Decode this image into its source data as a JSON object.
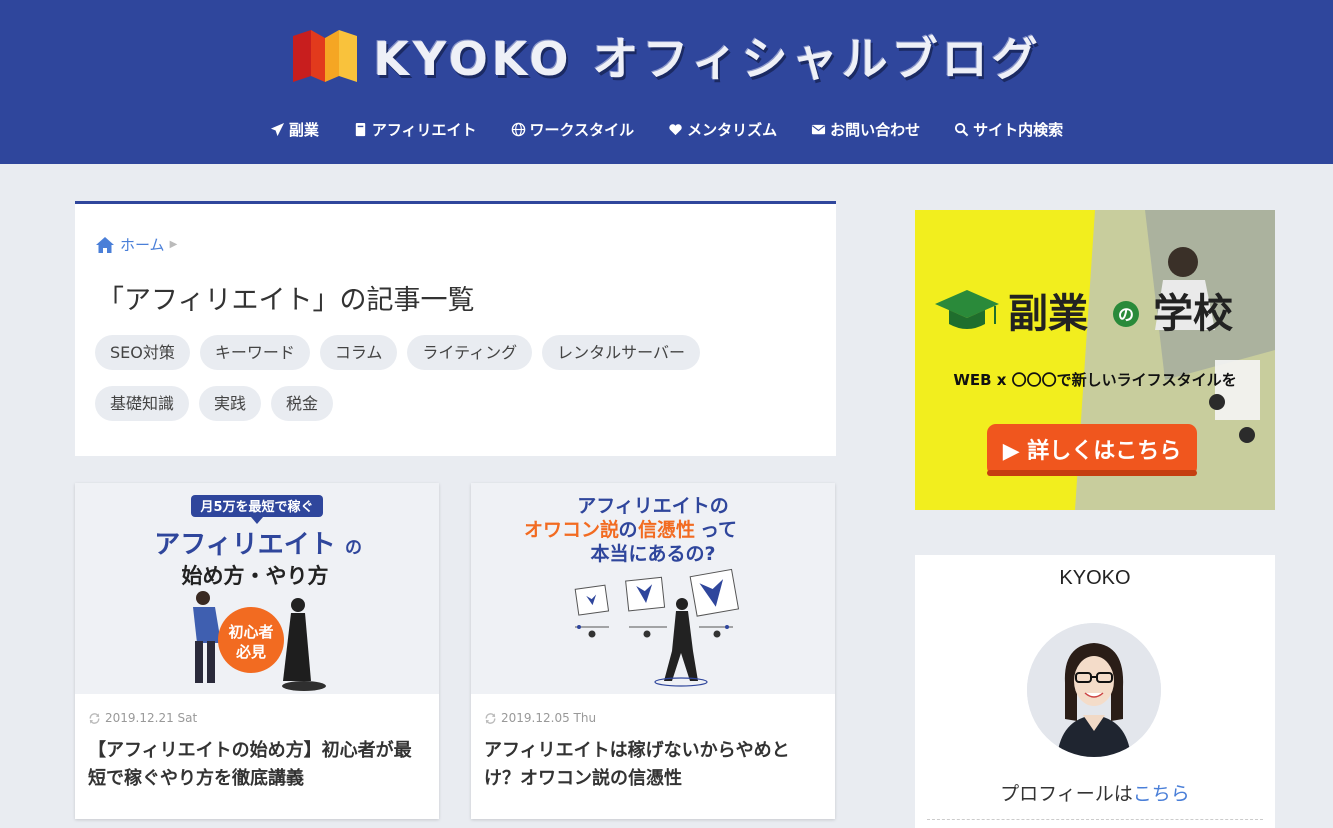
{
  "header": {
    "logo_text": "KYOKO オフィシャルブログ",
    "brand_color": "#2f469c",
    "nav": [
      {
        "label": "副業",
        "icon": "paper-plane-icon"
      },
      {
        "label": "アフィリエイト",
        "icon": "book-icon"
      },
      {
        "label": "ワークスタイル",
        "icon": "globe-icon"
      },
      {
        "label": "メンタリズム",
        "icon": "heart-icon"
      },
      {
        "label": "お問い合わせ",
        "icon": "envelope-icon"
      },
      {
        "label": "サイト内検索",
        "icon": "search-icon"
      }
    ]
  },
  "archive": {
    "breadcrumb_home": "ホーム",
    "title": "「アフィリエイト」の記事一覧",
    "tags": [
      "SEO対策",
      "キーワード",
      "コラム",
      "ライティング",
      "レンタルサーバー",
      "基礎知識",
      "実践",
      "税金"
    ]
  },
  "articles": [
    {
      "date": "2019.12.21 Sat",
      "title": "【アフィリエイトの始め方】初心者が最短で稼ぐやり方を徹底講義",
      "thumb": {
        "badge": "月5万を最短で稼ぐ",
        "headline_1": "アフィリエイト",
        "headline_1_suffix": "の",
        "headline_2": "始め方・やり方",
        "circle_1": "初心者",
        "circle_2": "必見"
      }
    },
    {
      "date": "2019.12.05 Thu",
      "title": "アフィリエイトは稼げないからやめとけ？オワコン説の信憑性",
      "thumb": {
        "line_1": "アフィリエイトの",
        "line_2a": "オワコン説",
        "line_2b": "の",
        "line_2c": "信憑性",
        "line_2d": "って",
        "line_3": "本当にあるの?"
      }
    }
  ],
  "sidebar": {
    "ad": {
      "title_1": "副業",
      "title_mid": "の",
      "title_2": "学校",
      "subtitle": "WEB x 〇〇〇で新しいライフスタイルを",
      "cta": "▶ 詳しくはこちら"
    },
    "profile": {
      "name": "KYOKO",
      "link_prefix": "プロフィールは",
      "link_text": "こちら"
    }
  }
}
